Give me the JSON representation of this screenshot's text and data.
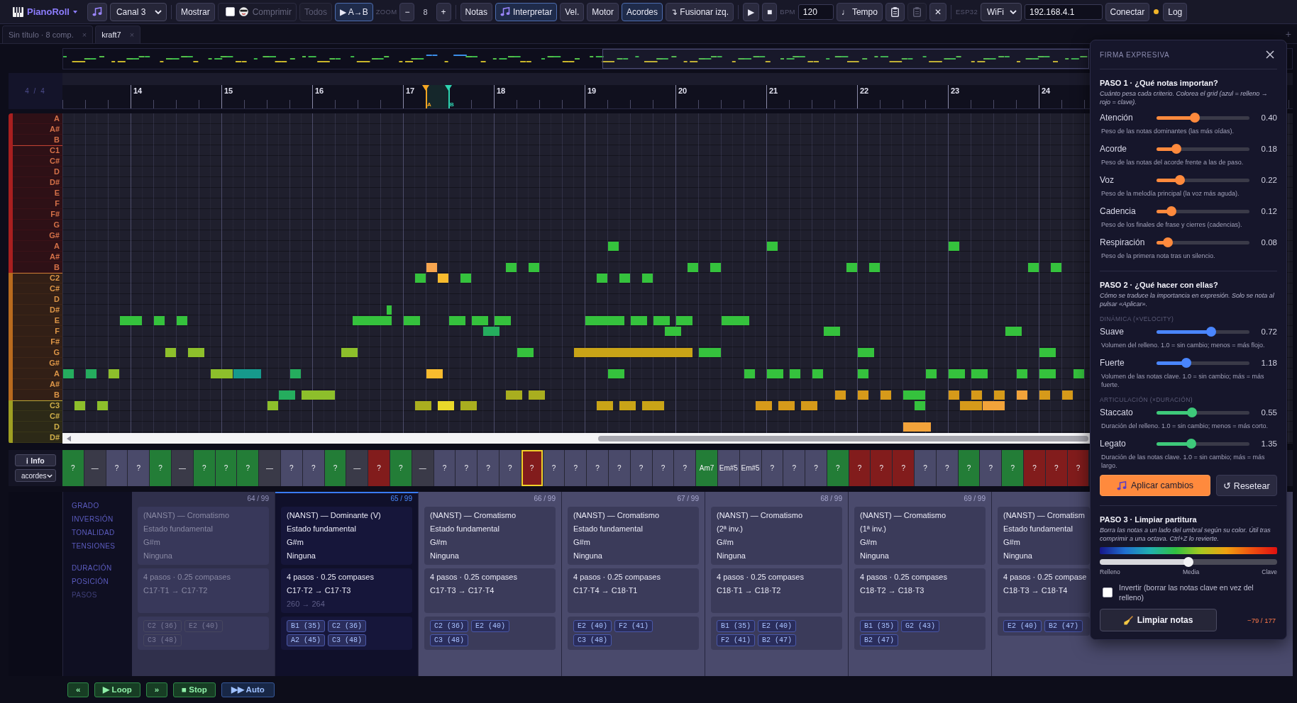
{
  "toolbar": [
    {
      "kind": "brand",
      "label": "PianoRoll"
    },
    {
      "kind": "music_button",
      "active": false,
      "disabled": false
    },
    {
      "kind": "select",
      "value": "Canal 3"
    },
    {
      "kind": "separator"
    },
    {
      "kind": "button",
      "label": "Mostrar",
      "active": false,
      "disabled": false
    },
    {
      "kind": "toggle",
      "label": "Comprimir",
      "checked": false,
      "disabled": true
    },
    {
      "kind": "button",
      "label": "Todos",
      "active": false,
      "disabled": true
    },
    {
      "kind": "button",
      "label": "▶ A→B",
      "active": true,
      "disabled": false
    },
    {
      "kind": "caption",
      "label": "ZOOM"
    },
    {
      "kind": "button",
      "label": "−",
      "active": false,
      "disabled": false
    },
    {
      "kind": "value",
      "label": "8"
    },
    {
      "kind": "button",
      "label": "+",
      "active": false,
      "disabled": false
    },
    {
      "kind": "separator"
    },
    {
      "kind": "button",
      "label": "Notas",
      "active": false,
      "disabled": false
    },
    {
      "kind": "music_button",
      "label": "Interpretar",
      "active": true,
      "disabled": false
    },
    {
      "kind": "button",
      "label": "Vel.",
      "active": false,
      "disabled": false
    },
    {
      "kind": "button",
      "label": "Motor",
      "active": false,
      "disabled": false
    },
    {
      "kind": "button",
      "label": "Acordes",
      "active": true,
      "disabled": false
    },
    {
      "kind": "button",
      "label": "↴ Fusionar izq.",
      "active": false,
      "disabled": false
    },
    {
      "kind": "separator"
    },
    {
      "kind": "button",
      "label": "▶",
      "active": false,
      "disabled": false
    },
    {
      "kind": "button",
      "label": "■",
      "active": false,
      "disabled": false
    },
    {
      "kind": "caption",
      "label": "BPM"
    },
    {
      "kind": "input",
      "value": "120"
    },
    {
      "kind": "button",
      "label": "♩ Tempo",
      "active": false,
      "disabled": false
    },
    {
      "kind": "clipboard_button",
      "active": false,
      "disabled": false
    },
    {
      "kind": "clipboard_button",
      "active": false,
      "disabled": true
    },
    {
      "kind": "button",
      "label": "✕",
      "active": false,
      "disabled": false
    },
    {
      "kind": "separator"
    },
    {
      "kind": "caption",
      "label": "ESP32"
    },
    {
      "kind": "select",
      "value": "WiFi"
    },
    {
      "kind": "input",
      "value": "192.168.4.1"
    },
    {
      "kind": "button",
      "label": "Conectar",
      "active": false,
      "disabled": false
    },
    {
      "kind": "status_dot",
      "color": "#f0b429"
    },
    {
      "kind": "button",
      "label": "Log",
      "active": false,
      "disabled": false
    }
  ],
  "tabs": [
    {
      "label": "Sin título · 8 comp.",
      "close": "×",
      "selected": false
    },
    {
      "label": "kraft7",
      "close": "×",
      "selected": true
    }
  ],
  "new_tab": "+",
  "piano_roll": {
    "time_signature": "4 / 4",
    "bars": [
      "14",
      "15",
      "16",
      "17",
      "18",
      "19",
      "20",
      "21",
      "22",
      "23",
      "24"
    ],
    "loop_markers": [
      {
        "label": "A",
        "color": "#f5a623"
      },
      {
        "label": "B",
        "color": "#2ed3b0"
      }
    ],
    "octaves": [
      {
        "color": "#a81f1f",
        "keys": [
          "A",
          "A#",
          "B"
        ]
      },
      {
        "color": "#a81f1f",
        "keys": [
          "C1",
          "C#",
          "D",
          "D#",
          "E",
          "F",
          "F#",
          "G",
          "G#",
          "A",
          "A#",
          "B"
        ]
      },
      {
        "color": "#b86a1e",
        "keys": [
          "C2",
          "C#",
          "D",
          "D#",
          "E",
          "F",
          "F#",
          "G",
          "G#",
          "A",
          "A#",
          "B"
        ]
      },
      {
        "color": "#9e9e22",
        "keys": [
          "C3",
          "C#",
          "D",
          "D#"
        ]
      }
    ]
  },
  "chord_strip": {
    "info_button": "ℹ Info",
    "view": "acordes",
    "chords": [
      {
        "label": "?",
        "color": "#237d37",
        "selected": false
      },
      {
        "label": "—",
        "color": "#3a3a48",
        "selected": false
      },
      {
        "label": "?",
        "color": "#4a4a6a",
        "selected": false
      },
      {
        "label": "?",
        "color": "#4a4a6a",
        "selected": false
      },
      {
        "label": "?",
        "color": "#237d37",
        "selected": false
      },
      {
        "label": "—",
        "color": "#3a3a48",
        "selected": false
      },
      {
        "label": "?",
        "color": "#237d37",
        "selected": false
      },
      {
        "label": "?",
        "color": "#237d37",
        "selected": false
      },
      {
        "label": "?",
        "color": "#237d37",
        "selected": false
      },
      {
        "label": "—",
        "color": "#3a3a48",
        "selected": false
      },
      {
        "label": "?",
        "color": "#4a4a6a",
        "selected": false
      },
      {
        "label": "?",
        "color": "#4a4a6a",
        "selected": false
      },
      {
        "label": "?",
        "color": "#237d37",
        "selected": false
      },
      {
        "label": "—",
        "color": "#3a3a48",
        "selected": false
      },
      {
        "label": "?",
        "color": "#821c1c",
        "selected": false
      },
      {
        "label": "?",
        "color": "#237d37",
        "selected": false
      },
      {
        "label": "—",
        "color": "#3a3a48",
        "selected": false
      },
      {
        "label": "?",
        "color": "#4a4a6a",
        "selected": false
      },
      {
        "label": "?",
        "color": "#4a4a6a",
        "selected": false
      },
      {
        "label": "?",
        "color": "#4a4a6a",
        "selected": false
      },
      {
        "label": "?",
        "color": "#4a4a6a",
        "selected": false
      },
      {
        "label": "?",
        "color": "#821c1c",
        "selected": true
      },
      {
        "label": "?",
        "color": "#4a4a6a",
        "selected": false
      },
      {
        "label": "?",
        "color": "#4a4a6a",
        "selected": false
      },
      {
        "label": "?",
        "color": "#4a4a6a",
        "selected": false
      },
      {
        "label": "?",
        "color": "#4a4a6a",
        "selected": false
      },
      {
        "label": "?",
        "color": "#4a4a6a",
        "selected": false
      },
      {
        "label": "?",
        "color": "#4a4a6a",
        "selected": false
      },
      {
        "label": "?",
        "color": "#4a4a6a",
        "selected": false
      },
      {
        "label": "Am7",
        "color": "#237d37",
        "selected": false
      },
      {
        "label": "Em#5",
        "color": "#4a4a6a",
        "selected": false
      },
      {
        "label": "Em#5",
        "color": "#4a4a6a",
        "selected": false
      },
      {
        "label": "?",
        "color": "#4a4a6a",
        "selected": false
      },
      {
        "label": "?",
        "color": "#4a4a6a",
        "selected": false
      },
      {
        "label": "?",
        "color": "#4a4a6a",
        "selected": false
      },
      {
        "label": "?",
        "color": "#237d37",
        "selected": false
      },
      {
        "label": "?",
        "color": "#821c1c",
        "selected": false
      },
      {
        "label": "?",
        "color": "#821c1c",
        "selected": false
      },
      {
        "label": "?",
        "color": "#821c1c",
        "selected": false
      },
      {
        "label": "?",
        "color": "#4a4a6a",
        "selected": false
      },
      {
        "label": "?",
        "color": "#4a4a6a",
        "selected": false
      },
      {
        "label": "?",
        "color": "#237d37",
        "selected": false
      },
      {
        "label": "?",
        "color": "#4a4a6a",
        "selected": false
      },
      {
        "label": "?",
        "color": "#237d37",
        "selected": false
      },
      {
        "label": "?",
        "color": "#821c1c",
        "selected": false
      },
      {
        "label": "?",
        "color": "#821c1c",
        "selected": false
      },
      {
        "label": "?",
        "color": "#821c1c",
        "selected": false
      }
    ]
  },
  "details": {
    "label_groups": [
      [
        {
          "text": "GRADO",
          "dimmed": false
        },
        {
          "text": "INVERSIÓN",
          "dimmed": false
        },
        {
          "text": "TONALIDAD",
          "dimmed": false
        },
        {
          "text": "TENSIONES",
          "dimmed": false
        }
      ],
      [
        {
          "text": "DURACIÓN",
          "dimmed": false
        },
        {
          "text": "POSICIÓN",
          "dimmed": false
        },
        {
          "text": "PASOS",
          "dimmed": true
        }
      ]
    ],
    "cards": [
      {
        "counter": "64 / 99",
        "selected": false,
        "dimmed": true,
        "harmony": [
          "(NANST) — Cromatismo",
          "Estado fundamental",
          "G#m",
          "Ninguna"
        ],
        "timing": [
          "4 pasos · 0.25 compases",
          "C17·T1 → C17·T2"
        ],
        "notes": [
          "C2 (36)",
          "E2 (40)",
          "C3 (48)"
        ]
      },
      {
        "counter": "65 / 99",
        "selected": true,
        "dimmed": false,
        "harmony": [
          "(NANST) — Dominante (V)",
          "Estado fundamental",
          "G#m",
          "Ninguna"
        ],
        "timing": [
          "4 pasos · 0.25 compases",
          "C17·T2 → C17·T3"
        ],
        "range": "260 → 264",
        "notes": [
          "B1 (35)",
          "C2 (36)",
          "A2 (45)",
          "C3 (48)"
        ]
      },
      {
        "counter": "66 / 99",
        "selected": false,
        "dimmed": false,
        "harmony": [
          "(NANST) — Cromatismo",
          "Estado fundamental",
          "G#m",
          "Ninguna"
        ],
        "timing": [
          "4 pasos · 0.25 compases",
          "C17·T3 → C17·T4"
        ],
        "notes": [
          "C2 (36)",
          "E2 (40)",
          "C3 (48)"
        ]
      },
      {
        "counter": "67 / 99",
        "selected": false,
        "dimmed": false,
        "harmony": [
          "(NANST) — Cromatismo",
          "Estado fundamental",
          "G#m",
          "Ninguna"
        ],
        "timing": [
          "4 pasos · 0.25 compases",
          "C17·T4 → C18·T1"
        ],
        "notes": [
          "E2 (40)",
          "F2 (41)",
          "C3 (48)"
        ]
      },
      {
        "counter": "68 / 99",
        "selected": false,
        "dimmed": false,
        "harmony": [
          "(NANST) — Cromatismo",
          "(2ª inv.)",
          "G#m",
          "Ninguna"
        ],
        "timing": [
          "4 pasos · 0.25 compases",
          "C18·T1 → C18·T2"
        ],
        "notes": [
          "B1 (35)",
          "E2 (40)",
          "F2 (41)",
          "B2 (47)"
        ]
      },
      {
        "counter": "69 / 99",
        "selected": false,
        "dimmed": false,
        "harmony": [
          "(NANST) — Cromatismo",
          "(1ª inv.)",
          "G#m",
          "Ninguna"
        ],
        "timing": [
          "4 pasos · 0.25 compases",
          "C18·T2 → C18·T3"
        ],
        "notes": [
          "B1 (35)",
          "G2 (43)",
          "B2 (47)"
        ]
      },
      {
        "selected": false,
        "dimmed": false,
        "harmony": [
          "(NANST) — Cromatism",
          "Estado fundamental",
          "G#m",
          "Ninguna"
        ],
        "timing": [
          "4 pasos · 0.25 compase",
          "C18·T3 → C18·T4"
        ],
        "notes": [
          "E2 (40)",
          "B2 (47)"
        ]
      }
    ]
  },
  "transport": [
    {
      "label": "«",
      "kind": "step"
    },
    {
      "label": "▶ Loop",
      "kind": "step"
    },
    {
      "label": "»",
      "kind": "step"
    },
    {
      "label": "■ Stop",
      "kind": "step"
    },
    {
      "label": "▶▶ Auto",
      "kind": "auto"
    }
  ],
  "panel": {
    "title": "FIRMA EXPRESIVA",
    "sections": [
      {
        "heading": "PASO 1 · ¿Qué notas importan?",
        "note": "Cuánto pesa cada criterio. Colorea el grid (azul = relleno → rojo = clave).",
        "groups": [
          {
            "color": "#ff8a3d",
            "sliders": [
              {
                "label": "Atención",
                "level": 0.4,
                "value": "0.40",
                "hint": "Peso de las notas dominantes (las más oídas)."
              },
              {
                "label": "Acorde",
                "level": 0.18,
                "value": "0.18",
                "hint": "Peso de las notas del acorde frente a las de paso."
              },
              {
                "label": "Voz",
                "level": 0.22,
                "value": "0.22",
                "hint": "Peso de la melodía principal (la voz más aguda)."
              },
              {
                "label": "Cadencia",
                "level": 0.12,
                "value": "0.12",
                "hint": "Peso de los finales de frase y cierres (cadencias)."
              },
              {
                "label": "Respiración",
                "level": 0.08,
                "value": "0.08",
                "hint": "Peso de la primera nota tras un silencio."
              }
            ]
          }
        ]
      },
      {
        "heading": "PASO 2 · ¿Qué hacer con ellas?",
        "note": "Cómo se traduce la importancia en expresión. Solo se nota al pulsar «Aplicar».",
        "groups": [
          {
            "caption": "DINÁMICA (×VELOCITY)",
            "color": "#4a86ff",
            "sliders": [
              {
                "label": "Suave",
                "level": 0.6,
                "value": "0.72",
                "hint": "Volumen del relleno. 1.0 = sin cambio; menos = más flojo."
              },
              {
                "label": "Fuerte",
                "level": 0.3,
                "value": "1.18",
                "hint": "Volumen de las notas clave. 1.0 = sin cambio; más = más fuerte."
              }
            ]
          },
          {
            "caption": "ARTICULACIÓN (×DURACIÓN)",
            "color": "#3ec97a",
            "sliders": [
              {
                "label": "Staccato",
                "level": 0.37,
                "value": "0.55",
                "hint": "Duración del relleno. 1.0 = sin cambio; menos = más corto."
              },
              {
                "label": "Legato",
                "level": 0.36,
                "value": "1.35",
                "hint": "Duración de las notas clave. 1.0 = sin cambio; más = más largo."
              }
            ]
          }
        ],
        "actions": [
          {
            "kind": "primary",
            "label": "Aplicar cambios"
          },
          {
            "kind": "secondary",
            "label": "↺ Resetear"
          }
        ]
      },
      {
        "heading": "PASO 3 · Limpiar partitura",
        "note": "Borra las notas a un lado del umbral según su color. Útil tras comprimir a una octava. Ctrl+Z lo revierte.",
        "threshold": {
          "level": 0.5,
          "labels": [
            "Relleno",
            "Media",
            "Clave"
          ]
        },
        "invert": {
          "label": "Invertir (borrar las notas clave en vez del relleno)",
          "checked": false
        },
        "clear_button": "Limpiar notas",
        "count": "−79 / 177"
      }
    ]
  }
}
